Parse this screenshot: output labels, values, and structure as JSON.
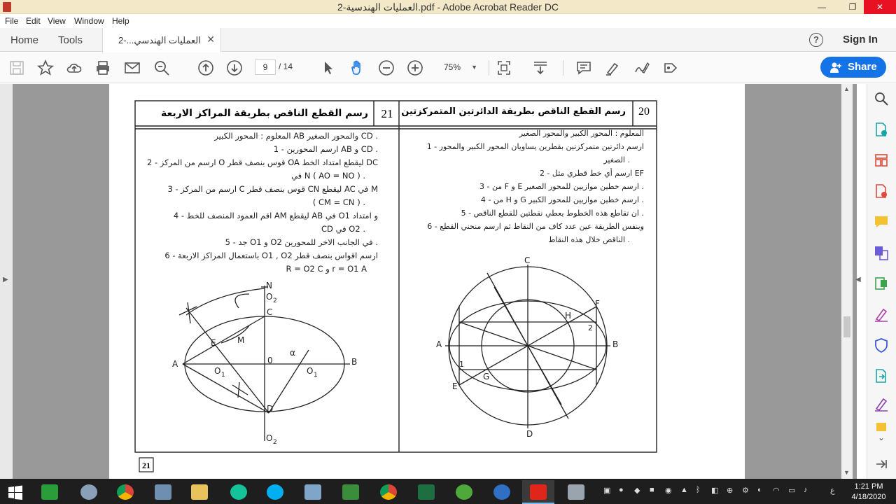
{
  "window": {
    "title": "العمليات الهندسية-2.pdf - Adobe Acrobat Reader DC",
    "minimize_glyph": "—",
    "restore_glyph": "❐",
    "close_glyph": "✕"
  },
  "menu": [
    "File",
    "Edit",
    "View",
    "Window",
    "Help"
  ],
  "tabs": {
    "home": "Home",
    "tools": "Tools",
    "document": "العمليات الهندسي...-2",
    "close_glyph": "✕"
  },
  "header": {
    "help_glyph": "?",
    "sign_in": "Sign In"
  },
  "toolbar": {
    "page_current": "9",
    "page_total": "/  14",
    "zoom": "75%",
    "share_label": "Share",
    "icons": [
      "save-icon",
      "bookmark-star-icon",
      "upload-cloud-icon",
      "print-icon",
      "email-icon",
      "search-zoom-icon",
      "page-up-icon",
      "page-down-icon",
      "select-arrow-icon",
      "hand-tool-icon",
      "zoom-out-icon",
      "zoom-in-icon",
      "fit-page-icon",
      "scroll-mode-icon",
      "comment-icon",
      "highlight-pen-icon",
      "sign-icon",
      "more-tools-icon"
    ]
  },
  "document": {
    "panel21": {
      "number": "21",
      "title": "رسم القطع الناقص بطريقة المراكز الاربعة",
      "lines": [
        "المعلوم : المحور الكبير  AB  والمحور الصغير  CD .",
        "1 - ارسم المحورين  AB  و  CD .",
        "2 - ارسم من المركز O قوس بنصف قطر OA ليقطع امتداد الخط DC",
        "في N  ( AO = NO ) .",
        "3 - ارسم من المركز  C  قوس بنصف قطر  CN  ليقطع  AC  في M",
        "( CM = CN ) .",
        "4 - اقم العمود المنصف للخط AM  ليقطع  AB  في  O1  و امتداد",
        "CD  في  O2 .",
        "5 - جد  O1  و  O2  في الجانب الاخر للمحورين .",
        "6 - باستعمال المراكز الاربعة  O1 , O2  ارسم اقواس بنصف قطر",
        "R = O2 C  و  r = O1 A"
      ],
      "labels": {
        "A": "A",
        "B": "B",
        "C": "C",
        "D": "D",
        "E": "E",
        "M": "M",
        "N": "N",
        "O": "0",
        "O1": "O",
        "O2": "O",
        "sub1": "1",
        "sub2": "2",
        "alpha": "α"
      }
    },
    "panel20": {
      "number": "20",
      "title": "رسم القطع الناقص بطريقة الدائرتين المتمركزتين",
      "lines": [
        "المعلوم : المحور الكبير والمحور الصغير",
        "1 - ارسم دائرتين متمركزتين بقطرين يساويان المحور الكبير والمحور",
        "الصغير .",
        "2 - ارسم  أي خط قطري مثل  EF",
        "3 - من  F  و  E  ارسم خطين موازيين للمحور الصغير .",
        "4 - من  H  و  G  ارسم خطين موازيين للمحور الكبير .",
        "5 - ان تقاطع هذه الخطوط يعطي نقطتين للقطع الناقص .",
        "6 - وبنفس الطريقة عين عدد كاف من النقاط ثم ارسم منحني القطع",
        "الناقص خلال هذه النقاط ."
      ],
      "labels": {
        "A": "A",
        "B": "B",
        "C": "C",
        "D": "D",
        "E": "E",
        "F": "F",
        "G": "G",
        "H": "H",
        "n1": "1",
        "n2": "2"
      }
    },
    "page_number": "21"
  },
  "taskbar": {
    "apps": [
      "windows-start-icon",
      "green-app-icon",
      "paint-icon",
      "chrome-icon",
      "calculator-icon",
      "file-explorer-icon",
      "grammarly-icon",
      "skype-icon",
      "folder-icon",
      "project-icon",
      "chrome-profile-icon",
      "excel-icon",
      "utorrent-icon",
      "globe-icon",
      "acrobat-icon",
      "tools-icon"
    ],
    "clock_time": "1:21 PM",
    "clock_date": "4/18/2020",
    "lang": "ع"
  },
  "colors": {
    "titlebar": "#f3e9c8",
    "share": "#1473e6",
    "close": "#e81123",
    "taskbar": "#1e1e1e",
    "ink": "#222222"
  }
}
